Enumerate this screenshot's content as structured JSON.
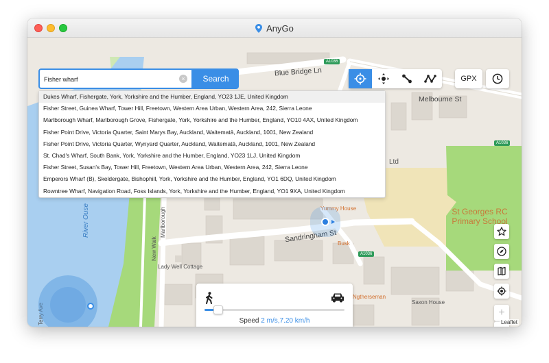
{
  "app": {
    "title": "AnyGo"
  },
  "search": {
    "value": "Fisher wharf",
    "button_label": "Search",
    "results": [
      "Dukes Wharf, Fishergate, York, Yorkshire and the Humber, England, YO23 1JE, United Kingdom",
      "Fisher Street, Guinea Wharf, Tower Hill, Freetown, Western Area Urban, Western Area, 242, Sierra Leone",
      "Marlborough Wharf, Marlborough Grove, Fishergate, York, Yorkshire and the Humber, England, YO10 4AX, United Kingdom",
      "Fisher Point Drive, Victoria Quarter, Saint Marys Bay, Auckland, Waitematā, Auckland, 1001, New Zealand",
      "Fisher Point Drive, Victoria Quarter, Wynyard Quarter, Auckland, Waitematā, Auckland, 1001, New Zealand",
      "St. Chad's Wharf, South Bank, York, Yorkshire and the Humber, England, YO23 1LJ, United Kingdom",
      "Fisher Street, Susan's Bay, Tower Hill, Freetown, Western Area Urban, Western Area, 242, Sierra Leone",
      "Emperors Wharf (B), Skeldergate, Bishophill, York, Yorkshire and the Humber, England, YO1 6DQ, United Kingdom",
      "Rowntree Wharf, Navigation Road, Foss Islands, York, Yorkshire and the Humber, England, YO1 9XA, United Kingdom"
    ]
  },
  "toolbar": {
    "modes": [
      {
        "icon": "crosshair-icon",
        "active": true
      },
      {
        "icon": "joystick-icon",
        "active": false
      },
      {
        "icon": "two-spot-route-icon",
        "active": false
      },
      {
        "icon": "multi-spot-route-icon",
        "active": false
      }
    ],
    "gpx_label": "GPX",
    "history_icon": "clock-icon"
  },
  "side_controls": {
    "favorite_icon": "star-icon",
    "compass_icon": "compass-icon",
    "map_icon": "map-icon",
    "locate_icon": "locate-icon",
    "zoom_in": "+",
    "zoom_out": "−"
  },
  "map": {
    "labels": {
      "blue_bridge_ln": "Blue Bridge Ln",
      "melbourne_st": "Melbourne St",
      "ltd": "Ltd",
      "st_georges_school": "St Georges RC Primary School",
      "sandringham_st": "Sandringham St",
      "yummy_house": "Yummy House",
      "busk": "Busk",
      "lady_well_cottage": "Lady Well Cottage",
      "river_ouse": "River Ouse",
      "new_walk": "New Walk",
      "marlborough": "Marlborough",
      "terry_ave": "Terry Ave",
      "saxon_house": "Saxon House",
      "ngtherseman": "Ngtherseman",
      "road_a1036": "A1036"
    },
    "attribution": "Leaflet"
  },
  "speed": {
    "label": "Speed",
    "value": "2 m/s,7.20 km/h",
    "slider_fraction": 0.07,
    "walk_icon": "walking-person-icon",
    "car_icon": "car-icon"
  },
  "colors": {
    "accent": "#3a8ee6",
    "water": "#a9cff0",
    "park": "#a6d97b",
    "school_grounds": "#f0e4b8"
  }
}
